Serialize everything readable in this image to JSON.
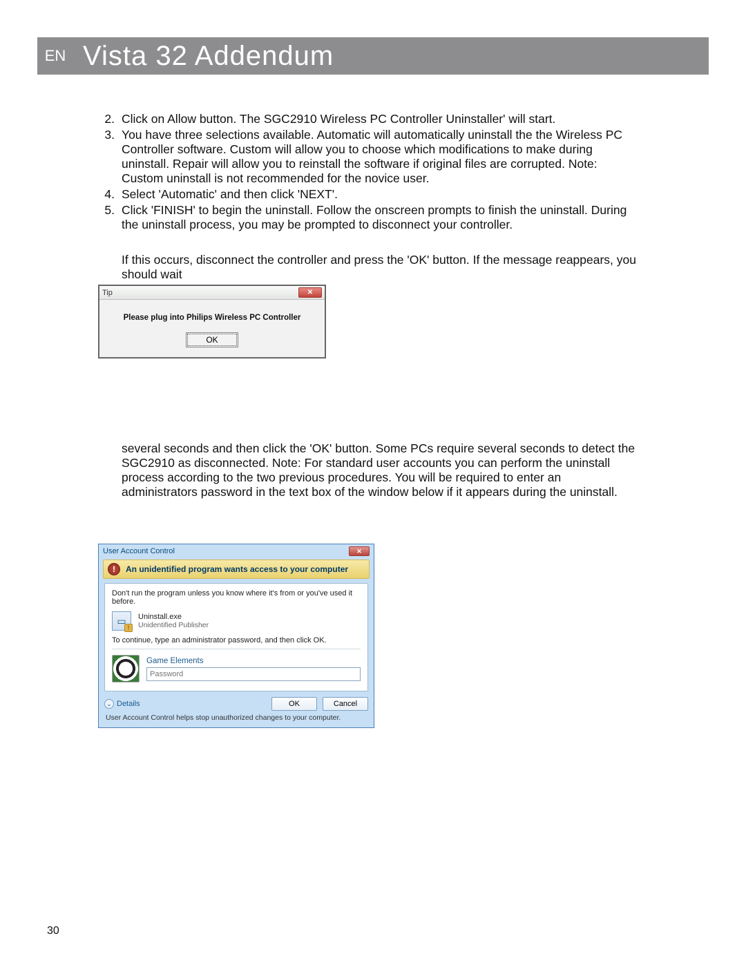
{
  "header": {
    "lang": "EN",
    "title": "Vista 32 Addendum"
  },
  "list": {
    "n2": "2.",
    "t2": "Click on Allow button. The SGC2910 Wireless PC Controller Uninstaller' will start.",
    "n3": "3.",
    "t3": "You have three selections available.  Automatic will automatically uninstall the the Wireless PC Controller software.  Custom will allow you to choose which modifications to make during uninstall.  Repair will allow you to reinstall the software if original files are corrupted.  Note:  Custom uninstall is not recommended for the novice user.",
    "n4": "4.",
    "t4": "Select 'Automatic' and then click 'NEXT'.",
    "n5": "5.",
    "t5": "Click 'FINISH' to begin the uninstall.  Follow the onscreen prompts to finish the uninstall.  During the uninstall process, you may be prompted to disconnect your controller."
  },
  "para1": "If this occurs, disconnect the controller and press the 'OK' button.  If the message reappears, you should wait",
  "tip": {
    "title": "Tip",
    "message": "Please plug into Philips Wireless PC Controller",
    "ok": "OK"
  },
  "para2": "several seconds and then click the 'OK' button.  Some PCs require several seconds to detect the SGC2910 as disconnected.  Note:  For standard user accounts you can perform the uninstall process according to the two previous procedures. You will be required to enter an administrators password in the text box of the window below if it appears during the uninstall.",
  "uac": {
    "title": "User Account Control",
    "band": "An unidentified program wants access to your computer",
    "warn": "Don't run the program unless you know where it's from or you've used it before.",
    "exe": "Uninstall.exe",
    "pub": "Unidentified Publisher",
    "cont": "To continue, type an administrator password, and then click OK.",
    "user": "Game Elements",
    "pwd_placeholder": "Password",
    "details": "Details",
    "ok": "OK",
    "cancel": "Cancel",
    "help": "User Account Control helps stop unauthorized changes to your computer."
  },
  "page_number": "30"
}
